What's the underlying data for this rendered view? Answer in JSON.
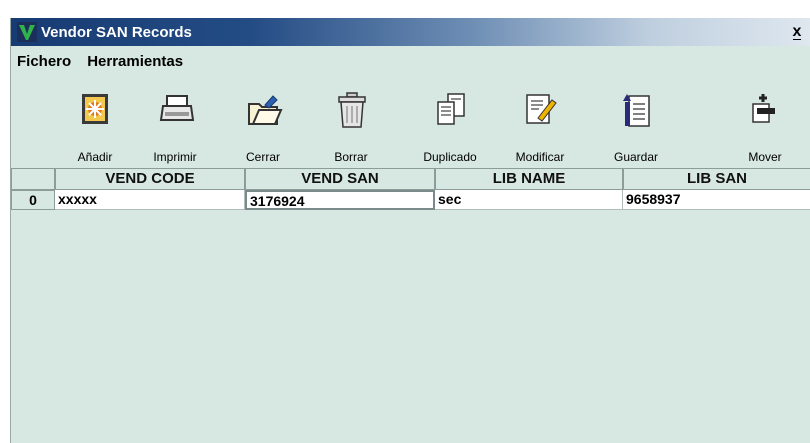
{
  "window": {
    "title": "Vendor SAN Records",
    "close_label": "x"
  },
  "menu": {
    "items": [
      {
        "label": "Fichero"
      },
      {
        "label": "Herramientas"
      }
    ]
  },
  "toolbar": {
    "buttons": [
      {
        "label": "Añadir",
        "icon": "add-icon"
      },
      {
        "label": "Imprimir",
        "icon": "printer-icon"
      },
      {
        "label": "Cerrar",
        "icon": "folder-close-icon"
      },
      {
        "label": "Borrar",
        "icon": "trash-icon"
      },
      {
        "label": "Duplicado",
        "icon": "duplicate-icon"
      },
      {
        "label": "Modificar",
        "icon": "edit-icon"
      },
      {
        "label": "Guardar",
        "icon": "save-icon"
      },
      {
        "label": "Mover",
        "icon": "move-icon"
      }
    ]
  },
  "table": {
    "columns": [
      "VEND CODE",
      "VEND SAN",
      "LIB NAME",
      "LIB SAN"
    ],
    "rows": [
      {
        "index": "0",
        "cells": [
          "xxxxx",
          "3176924",
          "sec",
          "9658937"
        ]
      }
    ]
  }
}
